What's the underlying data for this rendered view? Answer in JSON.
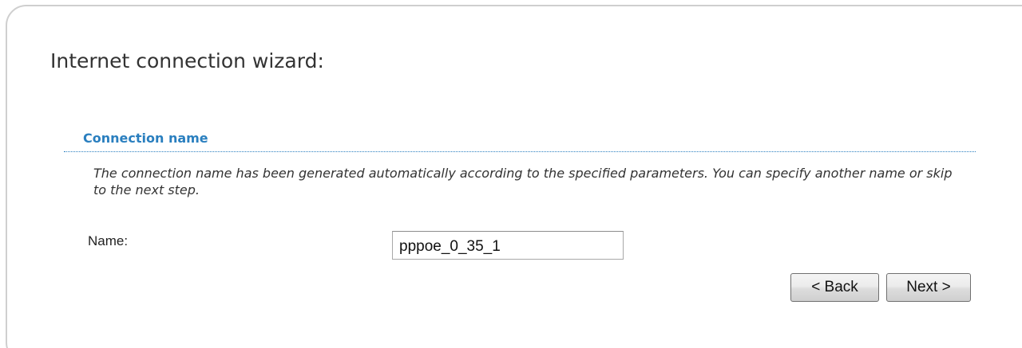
{
  "wizard": {
    "title": "Internet connection wizard:"
  },
  "section": {
    "title": "Connection name",
    "description": "The connection name has been generated automatically according to the specified parameters. You can specify another name or skip to the next step."
  },
  "form": {
    "name_label": "Name:",
    "name_value": "pppoe_0_35_1"
  },
  "buttons": {
    "back_label": "< Back",
    "next_label": "Next >"
  },
  "colors": {
    "accent": "#2a7fbf",
    "panel_border": "#cfcfcf"
  }
}
